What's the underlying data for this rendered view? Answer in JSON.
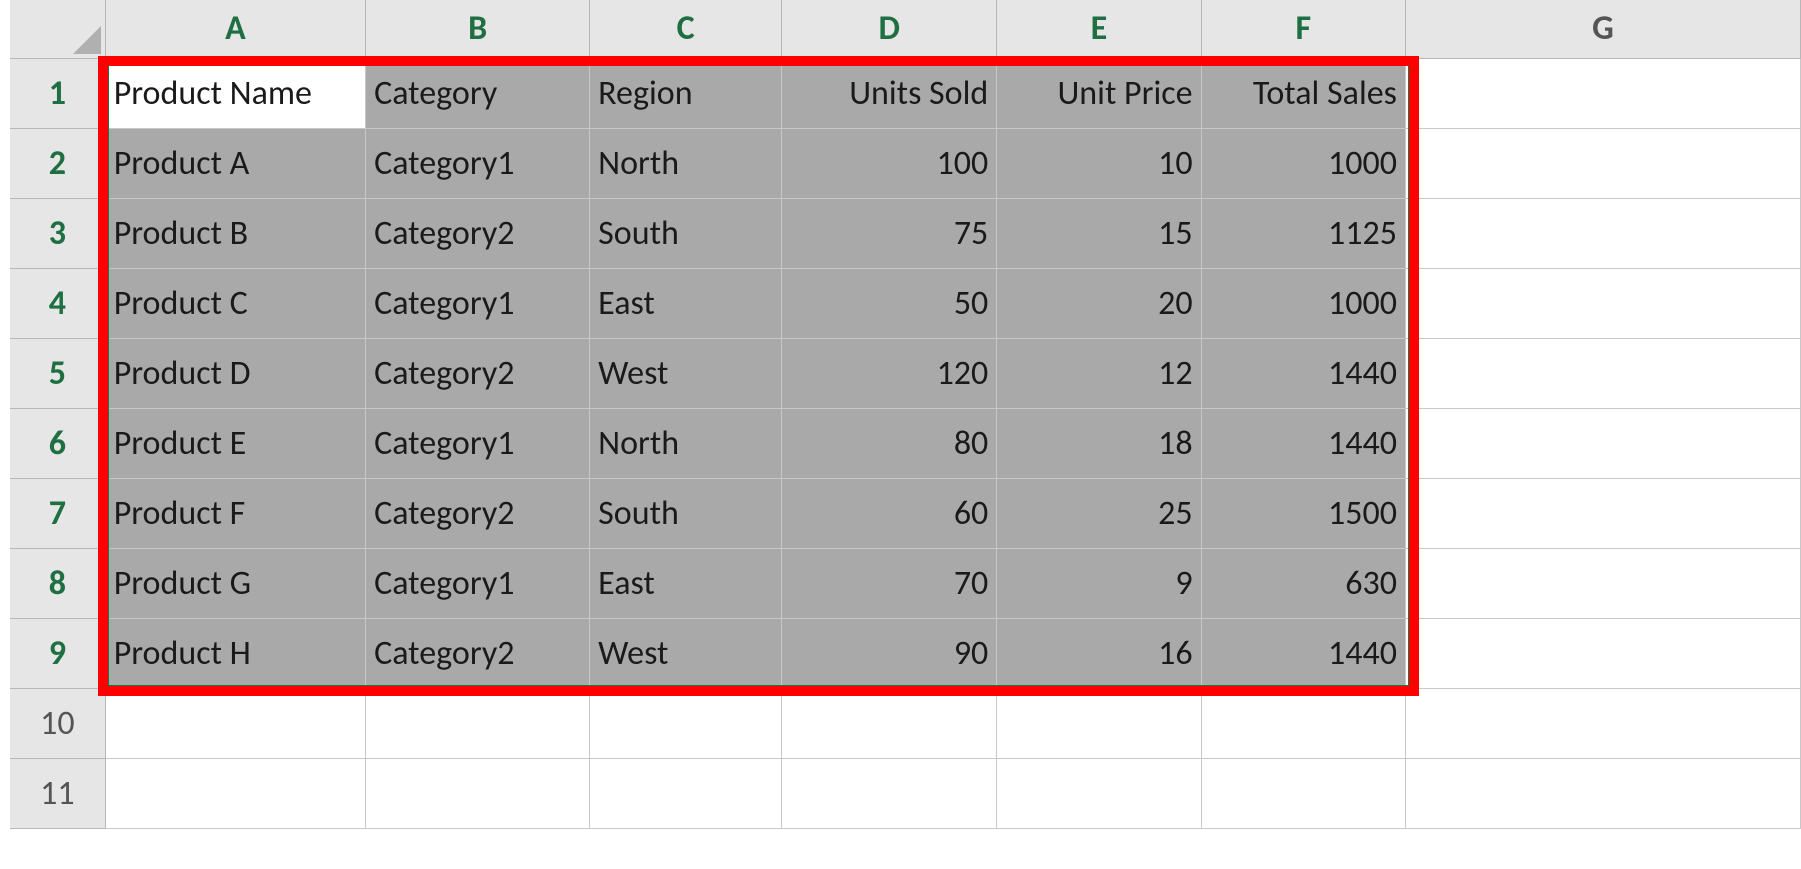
{
  "columns": [
    "A",
    "B",
    "C",
    "D",
    "E",
    "F",
    "G"
  ],
  "row_numbers": [
    1,
    2,
    3,
    4,
    5,
    6,
    7,
    8,
    9,
    10,
    11
  ],
  "selected_col_count": 6,
  "selected_row_count": 9,
  "active_cell": "A1",
  "headers": {
    "A": "Product Name",
    "B": "Category",
    "C": "Region",
    "D": "Units Sold",
    "E": "Unit Price",
    "F": "Total Sales"
  },
  "rows": [
    {
      "A": "Product A",
      "B": "Category1",
      "C": "North",
      "D": "100",
      "E": "10",
      "F": "1000"
    },
    {
      "A": "Product B",
      "B": "Category2",
      "C": "South",
      "D": "75",
      "E": "15",
      "F": "1125"
    },
    {
      "A": "Product C",
      "B": "Category1",
      "C": "East",
      "D": "50",
      "E": "20",
      "F": "1000"
    },
    {
      "A": "Product D",
      "B": "Category2",
      "C": "West",
      "D": "120",
      "E": "12",
      "F": "1440"
    },
    {
      "A": "Product E",
      "B": "Category1",
      "C": "North",
      "D": "80",
      "E": "18",
      "F": "1440"
    },
    {
      "A": "Product F",
      "B": "Category2",
      "C": "South",
      "D": "60",
      "E": "25",
      "F": "1500"
    },
    {
      "A": "Product G",
      "B": "Category1",
      "C": "East",
      "D": "70",
      "E": "9",
      "F": "630"
    },
    {
      "A": "Product H",
      "B": "Category2",
      "C": "West",
      "D": "90",
      "E": "16",
      "F": "1440"
    }
  ],
  "colors": {
    "header_green": "#1e6f42",
    "selection_green": "#107c41",
    "selection_fill": "#a9a9a9",
    "annotation_red": "#ff0000"
  }
}
